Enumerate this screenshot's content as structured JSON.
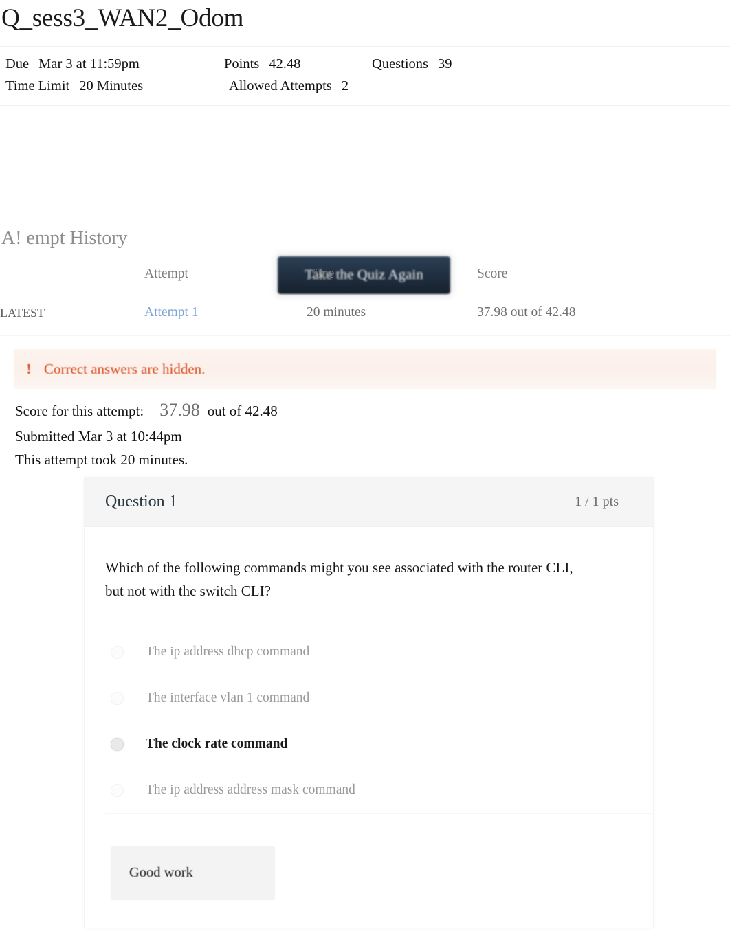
{
  "quiz": {
    "title": "Q_sess3_WAN2_Odom",
    "meta": {
      "due_label": "Due",
      "due_value": "Mar 3 at 11:59pm",
      "points_label": "Points",
      "points_value": "42.48",
      "questions_label": "Questions",
      "questions_value": "39",
      "time_limit_label": "Time Limit",
      "time_limit_value": "20 Minutes",
      "allowed_attempts_label": "Allowed Attempts",
      "allowed_attempts_value": "2"
    },
    "take_again_label": "Take the Quiz Again"
  },
  "attempt_history": {
    "heading": "A! empt History",
    "columns": {
      "blank": "",
      "attempt": "Attempt",
      "time": "Time",
      "score": "Score"
    },
    "rows": [
      {
        "latest": "LATEST",
        "attempt": "Attempt 1",
        "time": "20 minutes",
        "score": "37.98 out of 42.48"
      }
    ]
  },
  "warning": {
    "icon": "!",
    "text": "Correct answers are hidden."
  },
  "score_summary": {
    "score_label": "Score for this attempt:",
    "score_value": "37.98",
    "score_out_of": "out of 42.48",
    "submitted": "Submitted Mar 3 at 10:44pm",
    "duration": "This attempt took 20 minutes."
  },
  "question": {
    "name": "Question 1",
    "points": "1 / 1 pts",
    "text": "Which of the following commands might you see associated with the router CLI, but not with the switch CLI?",
    "answers": [
      {
        "label": "The ip address dhcp command",
        "selected": false
      },
      {
        "label": "The interface vlan 1 command",
        "selected": false
      },
      {
        "label": "The clock rate command",
        "selected": true
      },
      {
        "label": "The ip address address mask command",
        "selected": false
      }
    ],
    "feedback": "Good work"
  },
  "colors": {
    "button_dark": "#16202c",
    "link_blue": "#7ba4d6",
    "warning_orange": "#d8491d",
    "header_gray": "#f5f5f5",
    "muted_text": "#9a9a9a"
  }
}
